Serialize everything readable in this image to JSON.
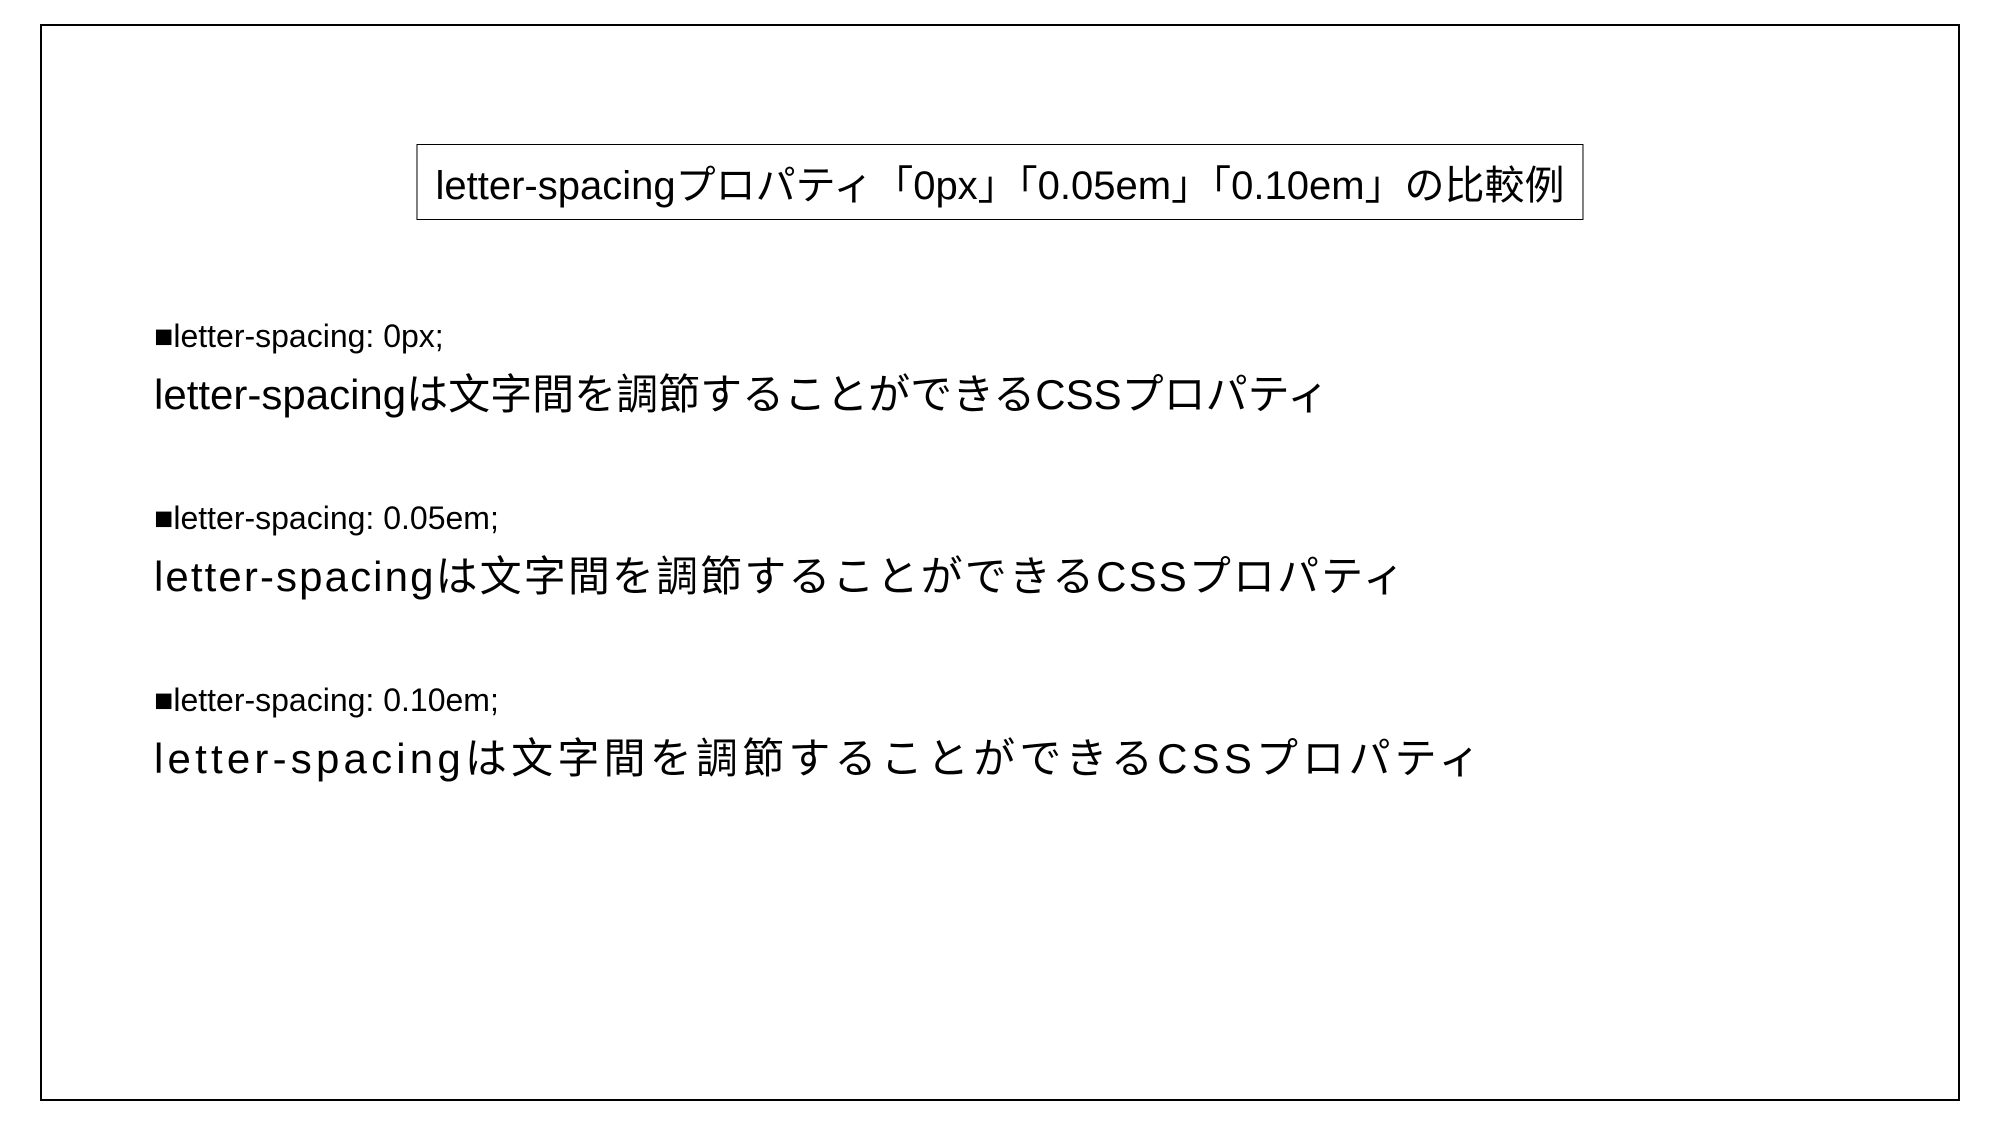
{
  "title": "letter-spacingプロパティ「0px」「0.05em」「0.10em」の比較例",
  "examples": [
    {
      "label": "■letter-spacing: 0px;",
      "text": "letter-spacingは文字間を調節することができるCSSプロパティ",
      "spacing": "0px"
    },
    {
      "label": "■letter-spacing: 0.05em;",
      "text": "letter-spacingは文字間を調節することができるCSSプロパティ",
      "spacing": "0.05em"
    },
    {
      "label": "■letter-spacing: 0.10em;",
      "text": "letter-spacingは文字間を調節することができるCSSプロパティ",
      "spacing": "0.10em"
    }
  ]
}
